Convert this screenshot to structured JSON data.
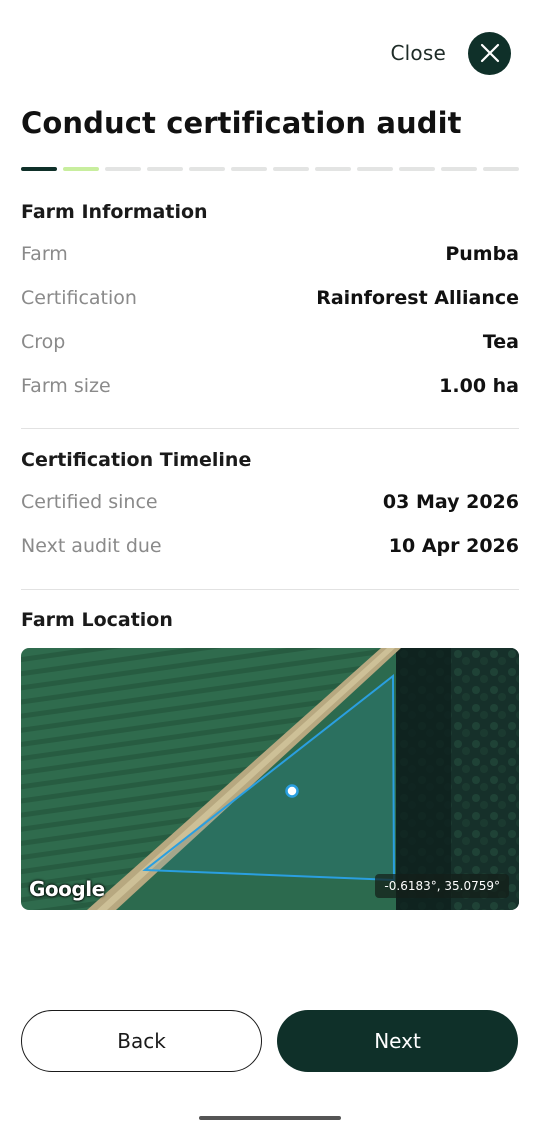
{
  "header": {
    "close_label": "Close",
    "close_icon": "close-icon",
    "title": "Conduct certification audit"
  },
  "progress": {
    "total_steps": 12,
    "completed_steps": 1,
    "current_step": 2,
    "colors": {
      "done": "#0f3029",
      "current": "#c8ee9e",
      "pending": "#e3e4e3"
    }
  },
  "farm_information": {
    "title": "Farm Information",
    "rows": [
      {
        "label": "Farm",
        "value": "Pumba"
      },
      {
        "label": "Certification",
        "value": "Rainforest Alliance"
      },
      {
        "label": "Crop",
        "value": "Tea"
      },
      {
        "label": "Farm size",
        "value": "1.00 ha"
      }
    ]
  },
  "certification_timeline": {
    "title": "Certification Timeline",
    "rows": [
      {
        "label": "Certified since",
        "value": "03 May 2026"
      },
      {
        "label": "Next audit due",
        "value": "10 Apr 2026"
      }
    ]
  },
  "farm_location": {
    "title": "Farm Location",
    "map_provider": "Google",
    "coordinates": "-0.6183°, 35.0759°"
  },
  "footer": {
    "back_label": "Back",
    "next_label": "Next"
  },
  "colors": {
    "primary": "#0f3029",
    "accent": "#c8ee9e",
    "polygon_stroke": "#2a9fe0"
  }
}
